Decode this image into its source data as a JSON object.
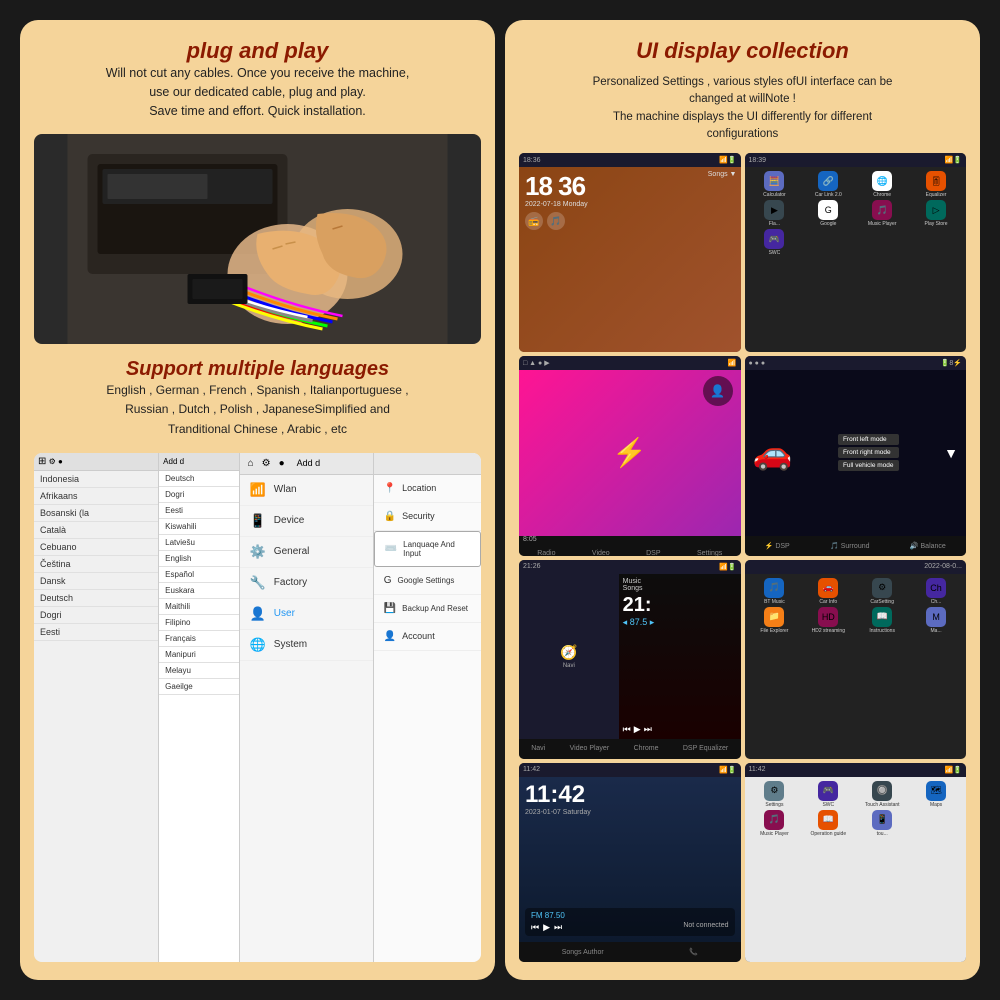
{
  "left": {
    "plug_title": "plug and play",
    "plug_body": "Will not cut any cables. Once you receive the machine,\nuse our dedicated cable, plug and play.\nSave time and effort. Quick installation.",
    "lang_title": "Support multiple languages",
    "lang_body": "English , German , French , Spanish , Italianportuguese ,\nRussian , Dutch , Polish , JapaneseSimplified and\nTranditional Chinese , Arabic , etc",
    "settings": {
      "topbar_add": "Add d",
      "topbar_add2": "Add d",
      "wlan": "Wlan",
      "device": "Device",
      "general": "General",
      "factory": "Factory",
      "user": "User",
      "system": "System",
      "location": "Location",
      "security": "Security",
      "language_input": "Lanquaqe And Input",
      "google_settings": "Google Settings",
      "backup_reset": "Backup And Reset",
      "account": "Account",
      "lang_items": [
        "Indonesia",
        "Afrikaans",
        "Bosanski (la",
        "Català",
        "Cebuano",
        "Čeština",
        "Dansk",
        "Deutsch",
        "Dogri"
      ],
      "lang_items2": [
        "Deutsch",
        "Dogri",
        "Eesti",
        "Kiswahili",
        "Latvieš u",
        "English",
        "Español",
        "Euskara",
        "Maithili",
        "Filipino",
        "Français",
        "Manipuri",
        "Melayu",
        "Gaeilge"
      ]
    }
  },
  "right": {
    "ui_title": "UI display collection",
    "ui_body": "Personalized Settings , various styles ofUI interface can be\nchanged at willNote !\nThe machine displays the UI differently for different\nconfigurations",
    "cells": [
      {
        "id": "clock",
        "time": "18 36",
        "date": "2022-07-18  Monday",
        "label": "clock-cell"
      },
      {
        "id": "apps1",
        "label": "apps-grid-cell",
        "time": "18:39"
      },
      {
        "id": "bluetooth",
        "label": "bluetooth-cell",
        "time": "8:05"
      },
      {
        "id": "car-dsp",
        "label": "car-dsp-cell"
      },
      {
        "id": "music",
        "label": "music-cell",
        "time": "21:",
        "num": "87.5"
      },
      {
        "id": "apps2",
        "label": "apps-grid-2"
      },
      {
        "id": "clock2",
        "time": "11:42",
        "date": "2023-01-07  Saturday",
        "label": "clock2-cell"
      },
      {
        "id": "settings2",
        "label": "settings-apps-cell"
      }
    ],
    "dsp_modes": [
      "Front left mode",
      "Front right mode",
      "Full vehicle mode"
    ],
    "dsp_bottom": [
      "DSP",
      "Surround",
      "Balance"
    ]
  },
  "colors": {
    "title_color": "#8B1A00",
    "bg_color": "#f5d49a",
    "dark_bg": "#1a1a1a"
  }
}
